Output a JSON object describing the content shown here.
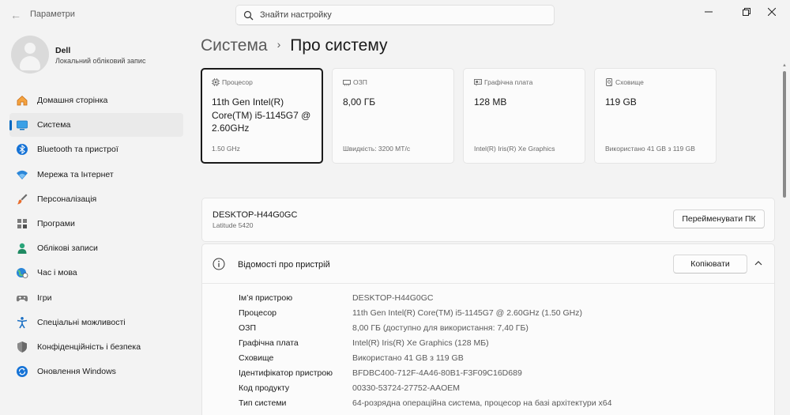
{
  "window": {
    "title": "Параметри",
    "back_glyph": "←",
    "minimize_glyph": "—",
    "maximize_glyph": "❐",
    "close_glyph": "✕"
  },
  "search": {
    "placeholder": "Знайти настройку"
  },
  "user": {
    "name": "Dell",
    "account_type": "Локальний обліковий запис"
  },
  "sidebar": {
    "items": [
      {
        "label": "Домашня сторінка",
        "icon": "home-icon",
        "active": false
      },
      {
        "label": "Система",
        "icon": "system-monitor-icon",
        "active": true
      },
      {
        "label": "Bluetooth та пристрої",
        "icon": "bluetooth-icon",
        "active": false
      },
      {
        "label": "Мережа та Інтернет",
        "icon": "wifi-icon",
        "active": false
      },
      {
        "label": "Персоналізація",
        "icon": "paint-brush-icon",
        "active": false
      },
      {
        "label": "Програми",
        "icon": "apps-icon",
        "active": false
      },
      {
        "label": "Облікові записи",
        "icon": "accounts-icon",
        "active": false
      },
      {
        "label": "Час і мова",
        "icon": "time-language-icon",
        "active": false
      },
      {
        "label": "Ігри",
        "icon": "gamepad-icon",
        "active": false
      },
      {
        "label": "Спеціальні можливості",
        "icon": "accessibility-icon",
        "active": false
      },
      {
        "label": "Конфіденційність і безпека",
        "icon": "shield-icon",
        "active": false
      },
      {
        "label": "Оновлення Windows",
        "icon": "windows-update-icon",
        "active": false
      }
    ]
  },
  "breadcrumb": {
    "parent": "Система",
    "separator": "›",
    "current": "Про систему"
  },
  "cards": [
    {
      "label": "Процесор",
      "icon": "cpu-icon",
      "value": "11th Gen Intel(R) Core(TM) i5-1145G7 @ 2.60GHz",
      "sub": "1.50 GHz"
    },
    {
      "label": "ОЗП",
      "icon": "ram-icon",
      "value": "8,00 ГБ",
      "sub": "Швидкість: 3200 MT/с"
    },
    {
      "label": "Графічна плата",
      "icon": "gpu-icon",
      "value": "128 MB",
      "sub": "Intel(R) Iris(R) Xe Graphics"
    },
    {
      "label": "Сховище",
      "icon": "storage-icon",
      "value": "119 GB",
      "sub": "Використано 41 GB з 119 GB"
    }
  ],
  "pc": {
    "name": "DESKTOP-H44G0GC",
    "model": "Latitude 5420",
    "rename_label": "Перейменувати ПК"
  },
  "specs": {
    "title": "Відомості про пристрій",
    "copy_label": "Копіювати",
    "rows": [
      {
        "key": "Ім’я пристрою",
        "value": "DESKTOP-H44G0GC"
      },
      {
        "key": "Процесор",
        "value": "11th Gen Intel(R) Core(TM) i5-1145G7 @ 2.60GHz (1.50 GHz)"
      },
      {
        "key": "ОЗП",
        "value": "8,00 ГБ (доступно для використання: 7,40 ГБ)"
      },
      {
        "key": "Графічна плата",
        "value": "Intel(R) Iris(R) Xe Graphics (128 МБ)"
      },
      {
        "key": "Сховище",
        "value": "Використано 41 GB з 119 GB"
      },
      {
        "key": "Ідентифікатор пристрою",
        "value": "BFDBC400-712F-4A46-80B1-F3F09C16D689"
      },
      {
        "key": "Код продукту",
        "value": "00330-53724-27752-AAOEM"
      },
      {
        "key": "Тип системи",
        "value": "64-розрядна операційна система, процесор на базі архітектури x64"
      }
    ]
  },
  "colors": {
    "accent": "#0067c0",
    "background": "#f3f3f3",
    "card": "#fbfbfb"
  }
}
